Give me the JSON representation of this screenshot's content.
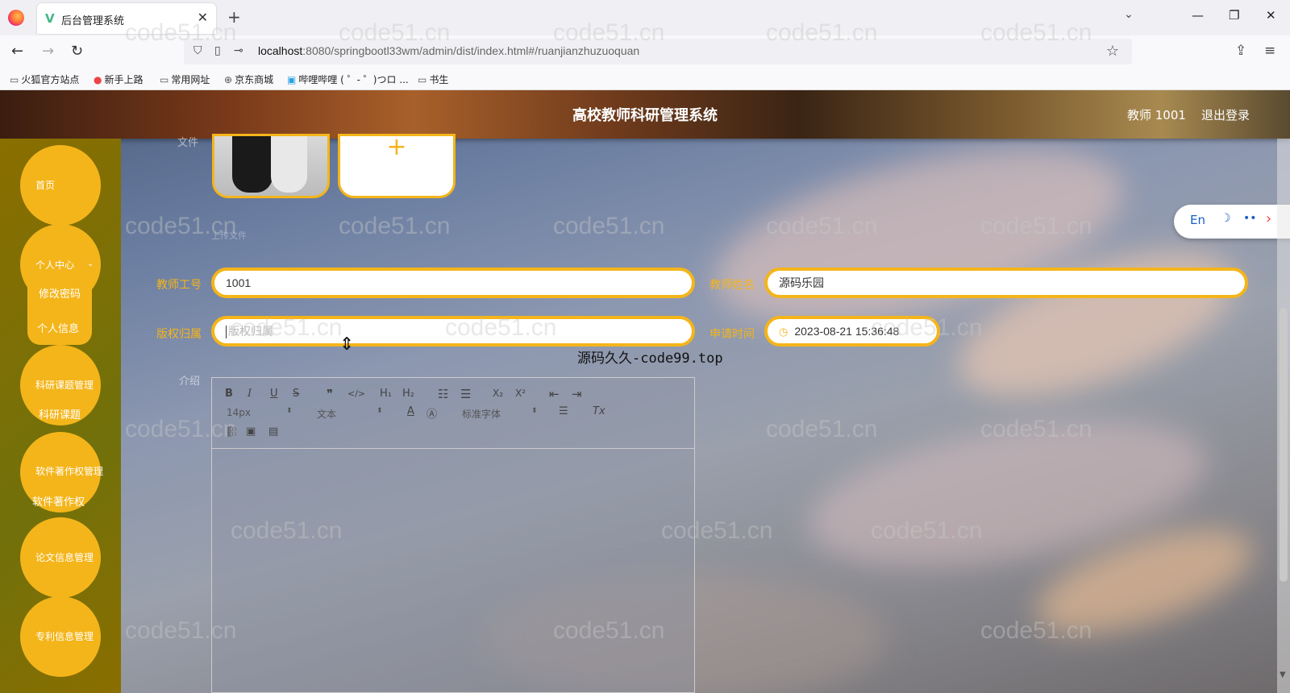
{
  "browser": {
    "tab_title": "后台管理系统",
    "tab_favicon": "V",
    "tab_close": "✕",
    "new_tab": "+",
    "url_host": "localhost",
    "url_path": ":8080/springbootl33wm/admin/dist/index.html#/ruanjianzhuzuoquan",
    "bookmarks": [
      "火狐官方站点",
      "新手上路",
      "常用网址",
      "京东商城",
      "哔哩哔哩 ( ゜- ゜)つロ ...",
      "书生"
    ]
  },
  "header": {
    "title": "高校教师科研管理系统",
    "user": "教师 1001",
    "logout": "退出登录"
  },
  "sidebar": {
    "items": [
      {
        "label": "首页"
      },
      {
        "label": "个人中心"
      },
      {
        "label": "科研课题管理"
      },
      {
        "label": "软件著作权管理"
      },
      {
        "label": "论文信息管理"
      },
      {
        "label": "专利信息管理"
      }
    ],
    "sub_items": {
      "personal": [
        "修改密码",
        "个人信息"
      ],
      "research": "科研课题",
      "software": "软件著作权"
    }
  },
  "form": {
    "file_label": "文件",
    "upload_plus": "+",
    "hint": "上传文件",
    "teacher_id_label": "教师工号",
    "teacher_id_value": "1001",
    "teacher_name_label": "教师姓名",
    "teacher_name_value": "源码乐园",
    "copyright_label": "版权归属",
    "copyright_placeholder": "版权归属",
    "apply_time_label": "申请时间",
    "apply_time_value": "2023-08-21 15:36:48",
    "intro_label": "介绍"
  },
  "editor": {
    "bold": "B",
    "italic": "I",
    "underline": "U",
    "strike": "S",
    "quote": "❞",
    "code": "</>",
    "h1": "H₁",
    "h2": "H₂",
    "ol": "☷",
    "ul": "☰",
    "sub": "X₂",
    "sup": "X²",
    "outdent": "⇤",
    "indent": "⇥",
    "font_size": "14px",
    "text_type": "文本",
    "font_family": "标准字体",
    "clear": "Tx"
  },
  "lang_switch": {
    "en": "En",
    "moon": "☽",
    "dots": "••",
    "arrow": "›"
  },
  "watermark": {
    "text": "code51.cn",
    "overlay": "源码久久-code99.top"
  }
}
